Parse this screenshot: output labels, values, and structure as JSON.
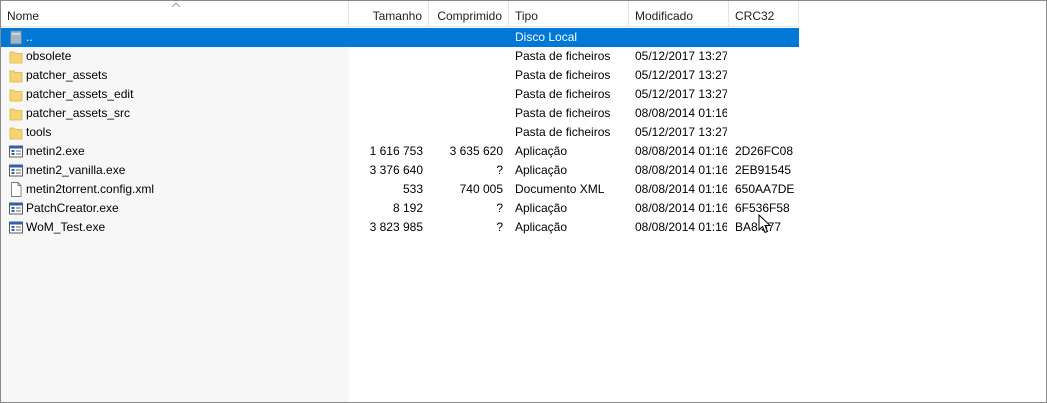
{
  "columns": {
    "name": "Nome",
    "size": "Tamanho",
    "compressed": "Comprimido",
    "type": "Tipo",
    "modified": "Modificado",
    "crc": "CRC32"
  },
  "rows": [
    {
      "name": "..",
      "size": "",
      "compressed": "",
      "type": "Disco Local",
      "modified": "",
      "crc": "",
      "icon": "drive-up-icon"
    },
    {
      "name": "obsolete",
      "size": "",
      "compressed": "",
      "type": "Pasta de ficheiros",
      "modified": "05/12/2017 13:27",
      "crc": "",
      "icon": "folder-icon"
    },
    {
      "name": "patcher_assets",
      "size": "",
      "compressed": "",
      "type": "Pasta de ficheiros",
      "modified": "05/12/2017 13:27",
      "crc": "",
      "icon": "folder-icon"
    },
    {
      "name": "patcher_assets_edit",
      "size": "",
      "compressed": "",
      "type": "Pasta de ficheiros",
      "modified": "05/12/2017 13:27",
      "crc": "",
      "icon": "folder-icon"
    },
    {
      "name": "patcher_assets_src",
      "size": "",
      "compressed": "",
      "type": "Pasta de ficheiros",
      "modified": "08/08/2014 01:16",
      "crc": "",
      "icon": "folder-icon"
    },
    {
      "name": "tools",
      "size": "",
      "compressed": "",
      "type": "Pasta de ficheiros",
      "modified": "05/12/2017 13:27",
      "crc": "",
      "icon": "folder-icon"
    },
    {
      "name": "metin2.exe",
      "size": "1 616 753",
      "compressed": "3 635 620",
      "type": "Aplicação",
      "modified": "08/08/2014 01:16",
      "crc": "2D26FC08",
      "icon": "exe-icon"
    },
    {
      "name": "metin2_vanilla.exe",
      "size": "3 376 640",
      "compressed": "?",
      "type": "Aplicação",
      "modified": "08/08/2014 01:16",
      "crc": "2EB91545",
      "icon": "exe-icon"
    },
    {
      "name": "metin2torrent.config.xml",
      "size": "533",
      "compressed": "740 005",
      "type": "Documento XML",
      "modified": "08/08/2014 01:16",
      "crc": "650AA7DE",
      "icon": "document-icon"
    },
    {
      "name": "PatchCreator.exe",
      "size": "8 192",
      "compressed": "?",
      "type": "Aplicação",
      "modified": "08/08/2014 01:16",
      "crc": "6F536F58",
      "icon": "exe-icon"
    },
    {
      "name": "WoM_Test.exe",
      "size": "3 823 985",
      "compressed": "?",
      "type": "Aplicação",
      "modified": "08/08/2014 01:16",
      "crc": "BA8 577",
      "icon": "exe-icon"
    }
  ],
  "selected_row": 0,
  "colors": {
    "selection": "#0078d7",
    "folder": "#f7d472",
    "exe_blue": "#2a62b8"
  }
}
